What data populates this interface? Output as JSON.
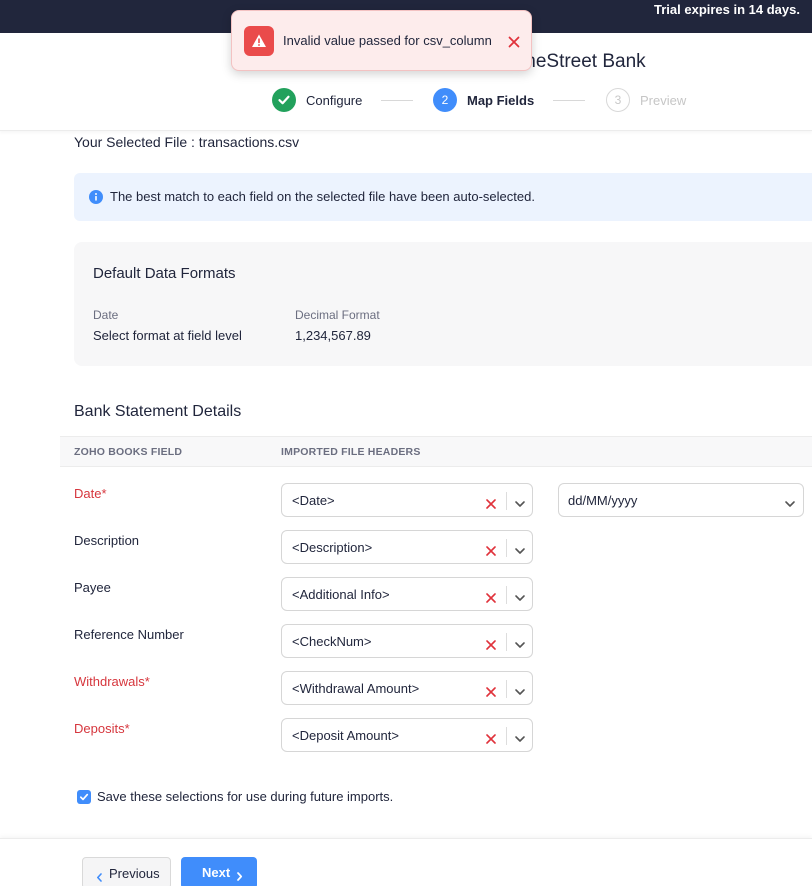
{
  "topbar": {
    "trial_text": "Trial expires in 14 days."
  },
  "toast": {
    "message": "Invalid value passed for csv_column"
  },
  "header": {
    "title": "meStreet Bank",
    "steps": [
      {
        "number": "1",
        "label": "Configure",
        "state": "done"
      },
      {
        "number": "2",
        "label": "Map Fields",
        "state": "active"
      },
      {
        "number": "3",
        "label": "Preview",
        "state": "todo"
      }
    ]
  },
  "selected_file": {
    "label": "Your Selected File :",
    "name": "transactions.csv"
  },
  "info_banner": {
    "text": "The best match to each field on the selected file have been auto-selected."
  },
  "default_formats": {
    "title": "Default Data Formats",
    "date": {
      "label": "Date",
      "value": "Select format at field level"
    },
    "decimal": {
      "label": "Decimal Format",
      "value": "1,234,567.89"
    }
  },
  "bank_statement": {
    "title": "Bank Statement Details",
    "col_zoho": "ZOHO BOOKS FIELD",
    "col_imported": "IMPORTED FILE HEADERS",
    "rows": [
      {
        "field": "Date*",
        "required": true,
        "header": "<Date>"
      },
      {
        "field": "Description",
        "required": false,
        "header": "<Description>"
      },
      {
        "field": "Payee",
        "required": false,
        "header": "<Additional Info>"
      },
      {
        "field": "Reference Number",
        "required": false,
        "header": "<CheckNum>"
      },
      {
        "field": "Withdrawals*",
        "required": true,
        "header": "<Withdrawal Amount>"
      },
      {
        "field": "Deposits*",
        "required": true,
        "header": "<Deposit Amount>"
      }
    ],
    "date_format": "dd/MM/yyyy"
  },
  "save_selection": {
    "checked": true,
    "label": "Save these selections for use during future imports."
  },
  "footer": {
    "previous_label": "Previous",
    "next_label": "Next"
  },
  "colors": {
    "accent": "#408dfb",
    "success": "#22a15c",
    "error": "#ea4b4b",
    "required": "#d6363d",
    "topbar": "#21263c"
  }
}
